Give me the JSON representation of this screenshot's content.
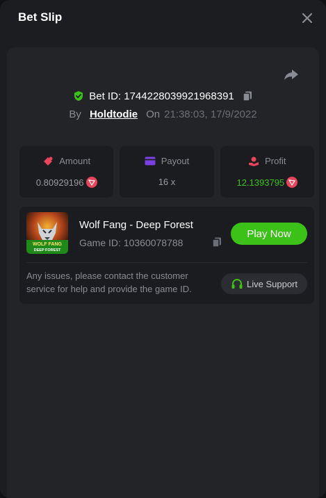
{
  "header": {
    "title": "Bet Slip"
  },
  "bet": {
    "id_label": "Bet ID: 1744228039921968391",
    "by_label": "By",
    "username": "Holdtodie",
    "on_label": "On",
    "datetime": "21:38:03, 17/9/2022"
  },
  "stats": {
    "amount": {
      "label": "Amount",
      "value": "0.80929196"
    },
    "payout": {
      "label": "Payout",
      "value": "16 x"
    },
    "profit": {
      "label": "Profit",
      "value": "12.1393795"
    }
  },
  "game": {
    "name": "Wolf Fang - Deep Forest",
    "id_label": "Game ID: 10360078788",
    "thumb_line1": "WOLF FANG",
    "thumb_line2": "DEEP FOREST",
    "play_label": "Play Now"
  },
  "support": {
    "notice": "Any issues, please contact the customer service for help and provide the game ID.",
    "button_label": "Live Support"
  },
  "colors": {
    "accent_green": "#3bc117",
    "shield_green": "#3bc117",
    "amount_icon": "#e9455a",
    "payout_icon": "#7b3fe4",
    "profit_icon": "#e9455a",
    "trx_red": "#e9455a"
  },
  "icons": [
    "close-icon",
    "share-icon",
    "shield-check-icon",
    "copy-icon",
    "amount-icon",
    "payout-card-icon",
    "profit-icon",
    "trx-coin-icon",
    "headset-icon"
  ]
}
